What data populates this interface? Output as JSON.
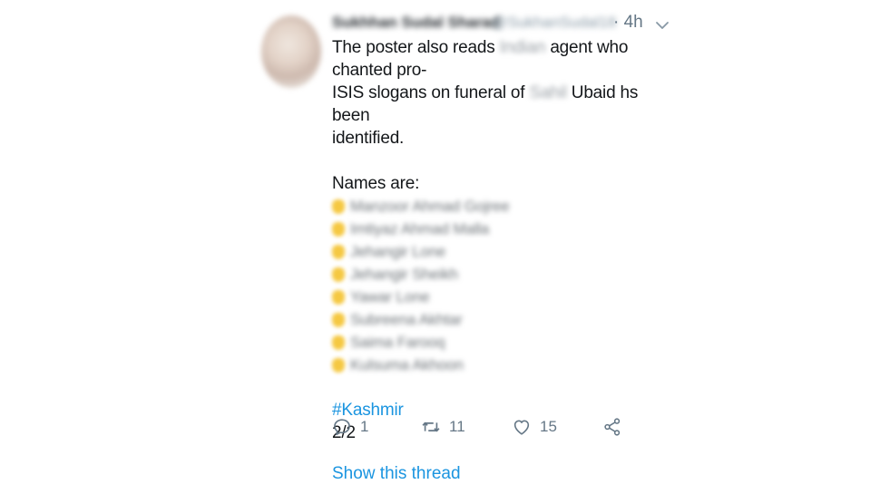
{
  "tweet": {
    "author_name": "Sukhhan Sudal Sharad",
    "author_handle": "@SukhanSudal18",
    "time": "· 4h",
    "body": {
      "line1_pre": "The poster also reads ",
      "line1_redacted": "Indian",
      "line1_post": " agent who chanted pro-",
      "line2_pre": "ISIS slogans on funeral of ",
      "line2_redacted": "Sahil",
      "line2_post": " Ubaid hs been",
      "line3": "identified.",
      "names_heading": "Names are:",
      "names": [
        "Manzoor Ahmad Gojree",
        "Imtiyaz Ahmad Malla",
        "Jehangir Lone",
        "Jehangir Sheikh",
        "Yawar Lone",
        "Subreena Akhtar",
        "Saima Farooq",
        "Kulsuma Akhoon"
      ],
      "hashtag": "#Kashmir",
      "thread_position": "2/2"
    },
    "actions": {
      "replies": "1",
      "retweets": "11",
      "likes": "15"
    },
    "show_thread_label": "Show this thread"
  },
  "icons": {
    "reply": "reply-icon",
    "retweet": "retweet-icon",
    "like": "heart-icon",
    "share": "share-icon",
    "caret": "chevron-down-icon",
    "pointing_hand": "pointing-hand-emoji"
  },
  "colors": {
    "link": "#1b95e0",
    "text": "#14171a",
    "muted": "#657786"
  }
}
